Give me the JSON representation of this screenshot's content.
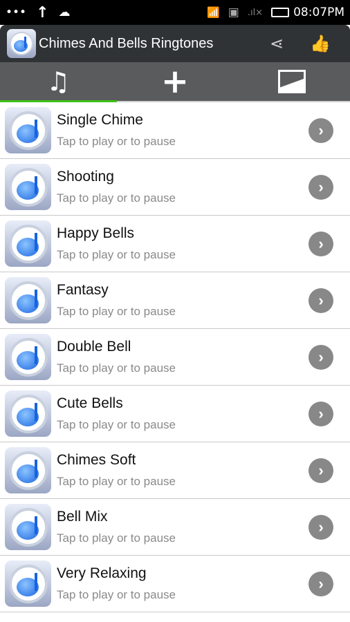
{
  "status": {
    "time": "08:07PM",
    "icons": [
      "more-dots-icon",
      "upload-arrow-icon",
      "weather-icon",
      "wifi-icon",
      "sim-error-icon",
      "signal-icon",
      "battery-icon"
    ]
  },
  "app": {
    "title": "Chimes And Bells Ringtones",
    "accent": "#3fc21a"
  },
  "tabs": [
    {
      "icon": "music-note-icon",
      "active": true
    },
    {
      "icon": "plus-icon"
    },
    {
      "icon": "image-icon"
    }
  ],
  "items": [
    {
      "name": "Single Chime",
      "subtitle": "Tap to play or to pause"
    },
    {
      "name": "Shooting",
      "subtitle": "Tap to play or to pause"
    },
    {
      "name": "Happy Bells",
      "subtitle": "Tap to play or to pause"
    },
    {
      "name": "Fantasy",
      "subtitle": "Tap to play or to pause"
    },
    {
      "name": "Double Bell",
      "subtitle": "Tap to play or to pause"
    },
    {
      "name": "Cute Bells",
      "subtitle": "Tap to play or to pause"
    },
    {
      "name": "Chimes Soft",
      "subtitle": "Tap to play or to pause"
    },
    {
      "name": "Bell Mix",
      "subtitle": "Tap to play or to pause"
    },
    {
      "name": "Very Relaxing",
      "subtitle": "Tap to play or to pause"
    }
  ]
}
